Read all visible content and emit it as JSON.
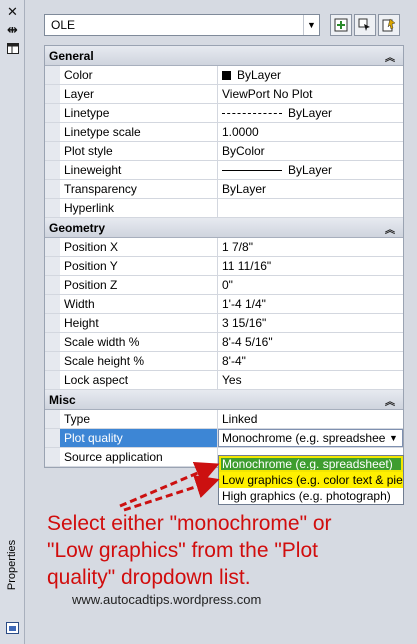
{
  "palette": {
    "title": "Properties"
  },
  "selector": {
    "value": "OLE"
  },
  "sections": [
    {
      "title": "General",
      "rows": [
        {
          "label": "Color",
          "value": "ByLayer",
          "swatch": "#000000"
        },
        {
          "label": "Layer",
          "value": "ViewPort No Plot"
        },
        {
          "label": "Linetype",
          "value": "ByLayer",
          "line": "dashed"
        },
        {
          "label": "Linetype scale",
          "value": "1.0000"
        },
        {
          "label": "Plot style",
          "value": "ByColor"
        },
        {
          "label": "Lineweight",
          "value": "ByLayer",
          "line": "solid"
        },
        {
          "label": "Transparency",
          "value": "ByLayer"
        },
        {
          "label": "Hyperlink",
          "value": ""
        }
      ]
    },
    {
      "title": "Geometry",
      "rows": [
        {
          "label": "Position X",
          "value": "1 7/8\""
        },
        {
          "label": "Position Y",
          "value": "11 11/16\""
        },
        {
          "label": "Position Z",
          "value": "0\""
        },
        {
          "label": "Width",
          "value": "1'-4 1/4\""
        },
        {
          "label": "Height",
          "value": "3 15/16\""
        },
        {
          "label": "Scale width  %",
          "value": "8'-4 5/16\""
        },
        {
          "label": "Scale height %",
          "value": "8'-4\""
        },
        {
          "label": "Lock aspect",
          "value": "Yes"
        }
      ]
    },
    {
      "title": "Misc",
      "rows": [
        {
          "label": "Type",
          "value": "Linked"
        },
        {
          "label": "Plot quality",
          "value": "Monochrome (e.g. spreadshee"
        },
        {
          "label": "Source application",
          "value": ""
        }
      ]
    }
  ],
  "dropdown_options": [
    "Monochrome (e.g. spreadsheet)",
    "Low graphics (e.g. color text & pie",
    "High graphics (e.g. photograph)"
  ],
  "annotation": {
    "line1": "Select either \"monochrome\" or",
    "line2": "\"Low graphics\" from the \"Plot",
    "line3": "quality\" dropdown list."
  },
  "website": "www.autocadtips.wordpress.com",
  "colors": {
    "selection": "#3d86d5",
    "annotation": "#d10d0d",
    "highlight_green": "#3e9d2f",
    "highlight_yellow": "#fff000"
  }
}
